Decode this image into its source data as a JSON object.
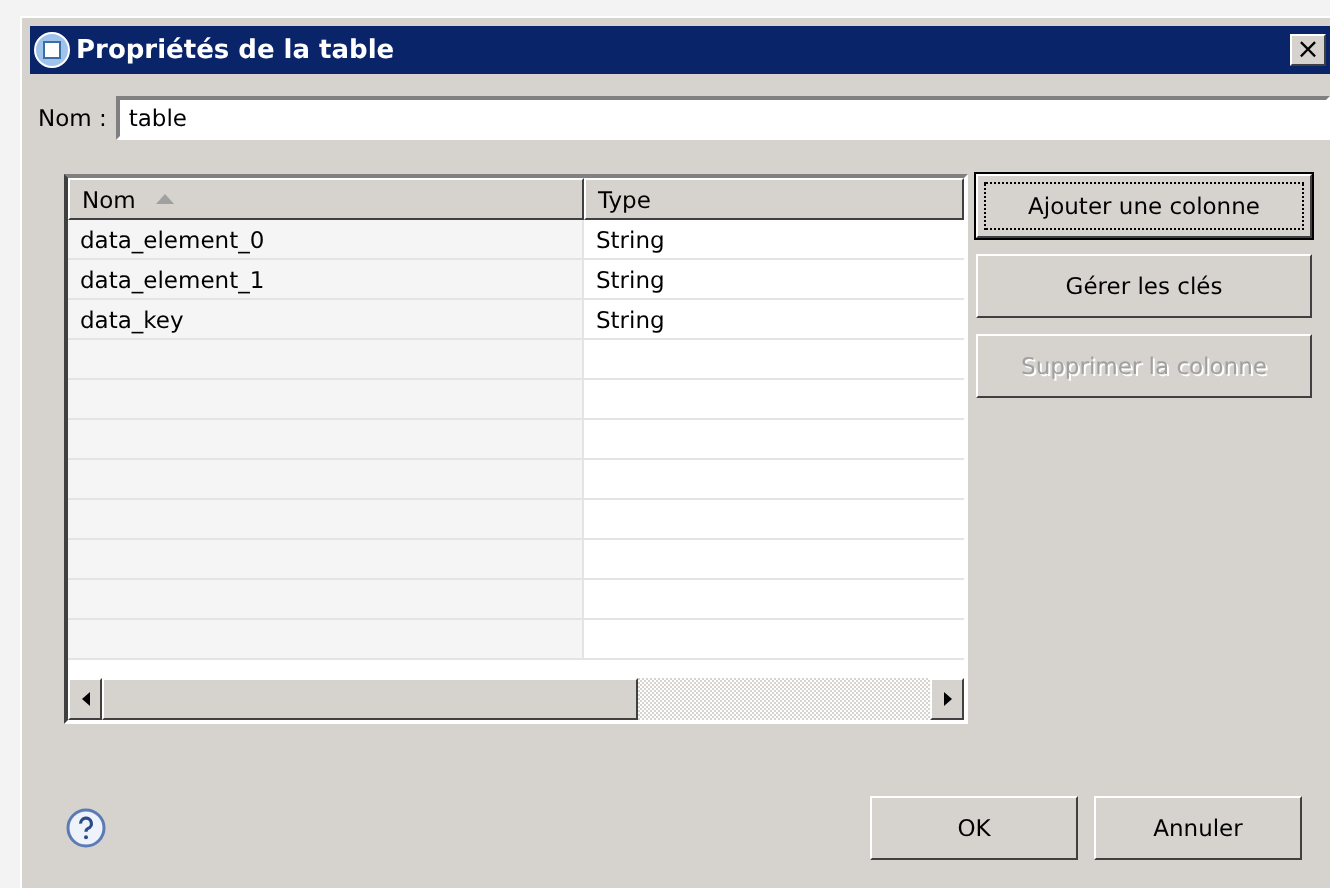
{
  "window": {
    "title": "Propriétés de la table",
    "close": "×"
  },
  "name_field": {
    "label": "Nom :",
    "value": "table"
  },
  "table": {
    "columns": [
      {
        "label": "Nom",
        "sorted": true
      },
      {
        "label": "Type",
        "sorted": false
      }
    ],
    "rows": [
      [
        "data_element_0",
        "String"
      ],
      [
        "data_element_1",
        "String"
      ],
      [
        "data_key",
        "String"
      ]
    ]
  },
  "side_buttons": [
    {
      "label": "Ajouter une colonne",
      "focused": true,
      "disabled": false
    },
    {
      "label": "Gérer les clés",
      "focused": false,
      "disabled": false
    },
    {
      "label": "Supprimer la colonne",
      "focused": false,
      "disabled": true
    }
  ],
  "footer_buttons": [
    "OK",
    "Annuler"
  ]
}
